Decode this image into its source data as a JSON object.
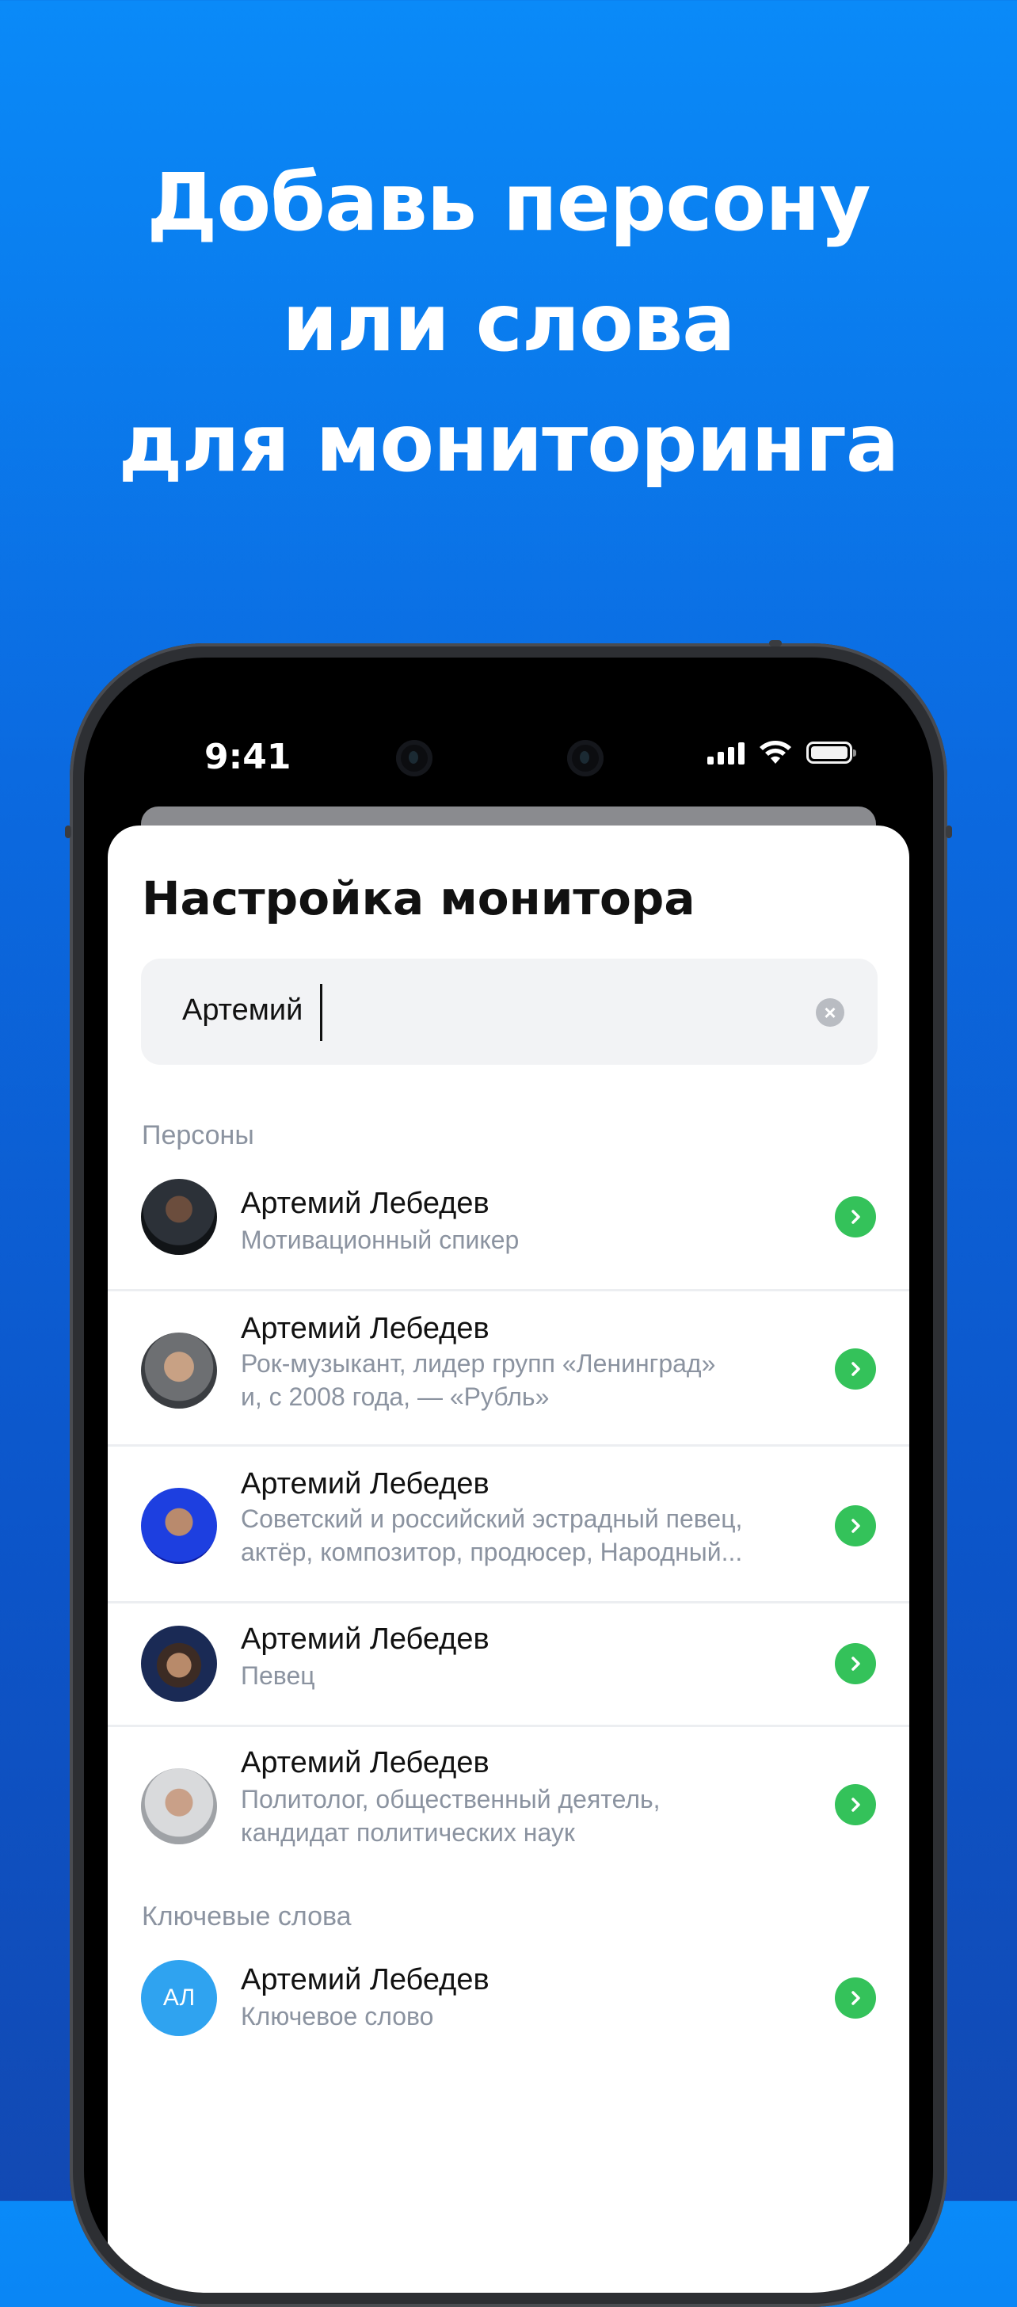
{
  "headline": [
    "Добавь персону",
    "или слова",
    "для мониторинга"
  ],
  "status_bar": {
    "time": "9:41"
  },
  "sheet": {
    "title": "Настройка монитора",
    "search": {
      "value": "Артемий"
    },
    "persons_label": "Персоны",
    "persons": [
      {
        "name": "Артемий Лебедев",
        "desc": [
          "Мотивационный спикер"
        ]
      },
      {
        "name": "Артемий Лебедев",
        "desc": [
          "Рок-музыкант, лидер групп «Ленинград»",
          "и, с 2008 года, — «Рубль»"
        ]
      },
      {
        "name": "Артемий Лебедев",
        "desc": [
          "Советский и российский эстрадный певец,",
          "актёр, композитор, продюсер, Народный..."
        ]
      },
      {
        "name": "Артемий Лебедев",
        "desc": [
          "Певец"
        ]
      },
      {
        "name": "Артемий Лебедев",
        "desc": [
          "Политолог, общественный деятель,",
          "кандидат политических наук"
        ]
      }
    ],
    "keywords_label": "Ключевые слова",
    "keywords": [
      {
        "initials": "АЛ",
        "name": "Артемий Лебедев",
        "desc": "Ключевое слово"
      }
    ]
  },
  "colors": {
    "accent_go": "#34c25a",
    "keyword_avatar": "#2fa3f0",
    "background_top": "#0a8af8",
    "background_bottom": "#1249b3"
  }
}
